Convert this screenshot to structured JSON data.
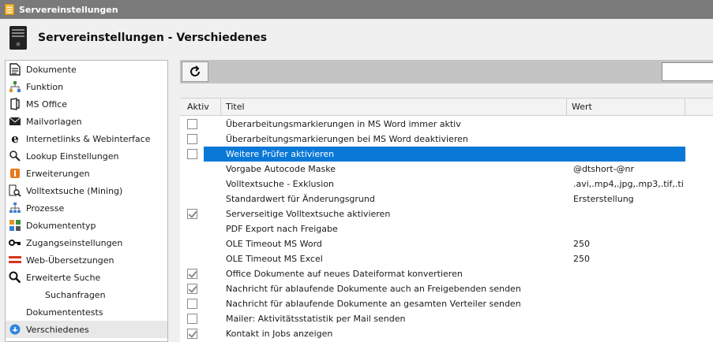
{
  "window": {
    "title": "Servereinstellungen"
  },
  "header": {
    "title": "Servereinstellungen - Verschiedenes"
  },
  "sidebar": {
    "items": [
      {
        "label": "Dokumente",
        "icon": "document-icon"
      },
      {
        "label": "Funktion",
        "icon": "function-tree-icon"
      },
      {
        "label": "MS Office",
        "icon": "office-icon"
      },
      {
        "label": "Mailvorlagen",
        "icon": "mail-icon"
      },
      {
        "label": "Internetlinks & Webinterface",
        "icon": "internet-explorer-icon"
      },
      {
        "label": "Lookup Einstellungen",
        "icon": "lookup-search-icon"
      },
      {
        "label": "Erweiterungen",
        "icon": "extension-icon"
      },
      {
        "label": "Volltextsuche (Mining)",
        "icon": "fulltext-search-icon"
      },
      {
        "label": "Prozesse",
        "icon": "process-icon"
      },
      {
        "label": "Dokumententyp",
        "icon": "document-type-icon"
      },
      {
        "label": "Zugangseinstellungen",
        "icon": "key-icon"
      },
      {
        "label": "Web-Übersetzungen",
        "icon": "translation-icon"
      },
      {
        "label": "Erweiterte Suche",
        "icon": "advanced-search-icon"
      },
      {
        "label": "Suchanfragen",
        "icon": ""
      },
      {
        "label": "Dokumententests",
        "icon": ""
      },
      {
        "label": "Verschiedenes",
        "icon": "misc-icon"
      }
    ]
  },
  "toolbar": {
    "search_value": ""
  },
  "grid": {
    "columns": [
      "Aktiv",
      "Titel",
      "Wert"
    ],
    "rows": [
      {
        "checkbox": true,
        "checked": false,
        "title": "Überarbeitungsmarkierungen in MS Word immer aktiv",
        "value": ""
      },
      {
        "checkbox": true,
        "checked": false,
        "title": "Überarbeitungsmarkierungen bei MS Word deaktivieren",
        "value": ""
      },
      {
        "checkbox": true,
        "checked": false,
        "title": "Weitere Prüfer aktivieren",
        "value": "",
        "selected": true
      },
      {
        "checkbox": false,
        "checked": false,
        "title": "Vorgabe Autocode Maske",
        "value": "@dtshort-@nr"
      },
      {
        "checkbox": false,
        "checked": false,
        "title": "Volltextsuche - Exklusion",
        "value": ".avi,.mp4,.jpg,.mp3,.tif,.ti..."
      },
      {
        "checkbox": false,
        "checked": false,
        "title": "Standardwert für Änderungsgrund",
        "value": "Ersterstellung"
      },
      {
        "checkbox": true,
        "checked": true,
        "title": "Serverseitige Volltextsuche aktivieren",
        "value": ""
      },
      {
        "checkbox": false,
        "checked": false,
        "title": "PDF Export nach Freigabe",
        "value": ""
      },
      {
        "checkbox": false,
        "checked": false,
        "title": "OLE Timeout MS Word",
        "value": "250"
      },
      {
        "checkbox": false,
        "checked": false,
        "title": "OLE Timeout MS Excel",
        "value": "250"
      },
      {
        "checkbox": true,
        "checked": true,
        "title": "Office Dokumente auf neues Dateiformat konvertieren",
        "value": ""
      },
      {
        "checkbox": true,
        "checked": true,
        "title": "Nachricht für ablaufende Dokumente auch an Freigebenden senden",
        "value": ""
      },
      {
        "checkbox": true,
        "checked": false,
        "title": "Nachricht für ablaufende Dokumente an gesamten Verteiler senden",
        "value": ""
      },
      {
        "checkbox": true,
        "checked": false,
        "title": "Mailer: Aktivitätsstatistik per Mail senden",
        "value": ""
      },
      {
        "checkbox": true,
        "checked": true,
        "title": "Kontakt in Jobs anzeigen",
        "value": ""
      }
    ]
  },
  "colors": {
    "selection": "#0a78d7",
    "toolbar": "#c4c4c4",
    "titlebar": "#7a7a7a"
  }
}
